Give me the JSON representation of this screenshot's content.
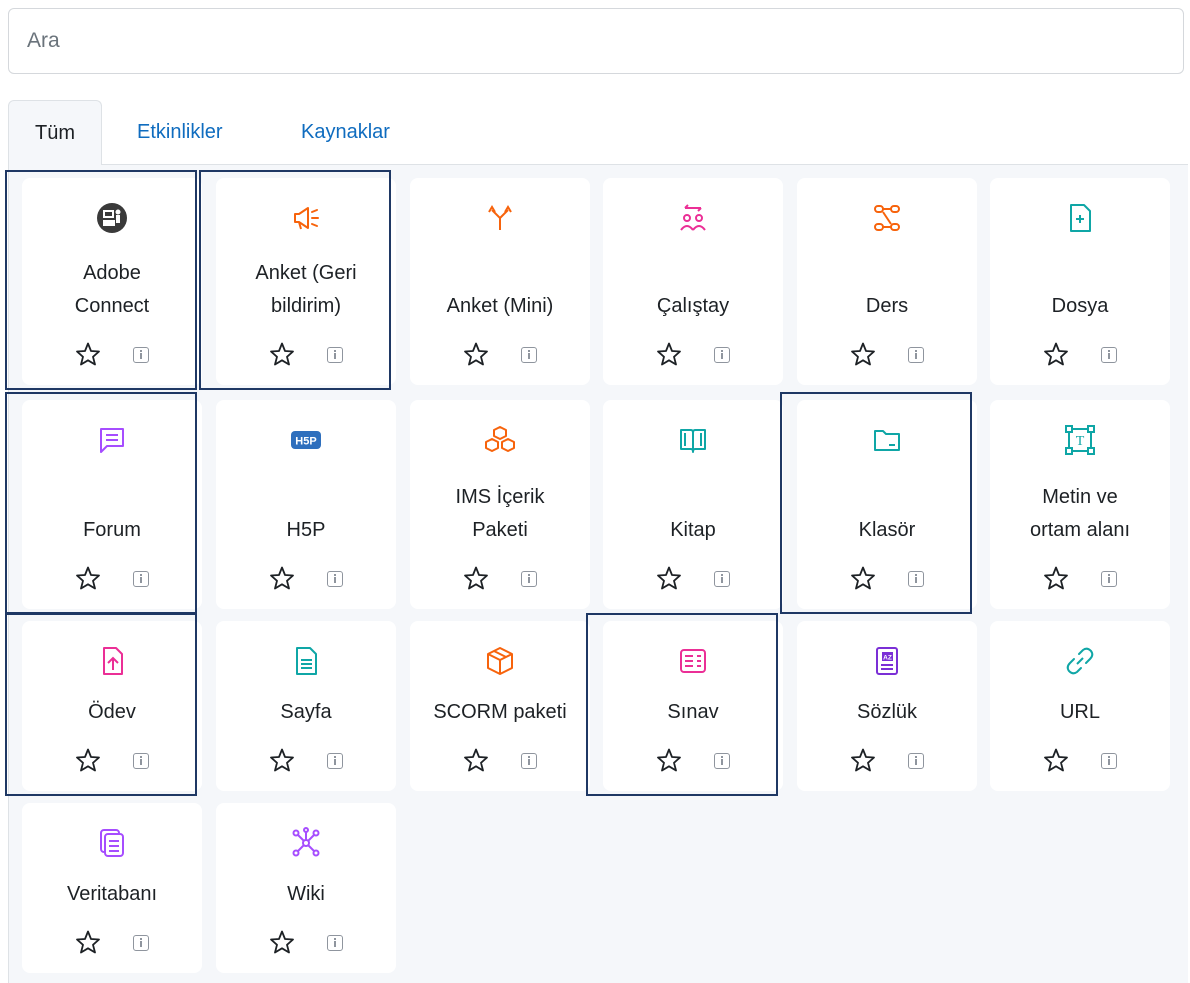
{
  "search": {
    "placeholder": "Ara",
    "value": ""
  },
  "tabs": [
    {
      "label": "Tüm",
      "active": true
    },
    {
      "label": "Etkinlikler",
      "active": false
    },
    {
      "label": "Kaynaklar",
      "active": false
    }
  ],
  "modules": [
    {
      "line1": "Adobe",
      "line2": "Connect",
      "icon": "adobe-connect-icon",
      "color": "#3a3a3a",
      "highlighted": true
    },
    {
      "line1": "Anket (Geri",
      "line2": "bildirim)",
      "icon": "megaphone-icon",
      "color": "#f7630c",
      "highlighted": true
    },
    {
      "line1": "",
      "line2": "Anket (Mini)",
      "icon": "split-arrow-icon",
      "color": "#f7630c",
      "highlighted": false
    },
    {
      "line1": "",
      "line2": "Çalıştay",
      "icon": "workshop-people-icon",
      "color": "#eb2f96",
      "highlighted": false
    },
    {
      "line1": "",
      "line2": "Ders",
      "icon": "lesson-path-icon",
      "color": "#f7630c",
      "highlighted": false
    },
    {
      "line1": "",
      "line2": "Dosya",
      "icon": "file-plus-icon",
      "color": "#0fa6a6",
      "highlighted": false
    },
    {
      "line1": "",
      "line2": "Forum",
      "icon": "forum-chat-icon",
      "color": "#a64dff",
      "highlighted": true
    },
    {
      "line1": "",
      "line2": "H5P",
      "icon": "h5p-icon",
      "color": "#2e6fbd",
      "highlighted": false
    },
    {
      "line1": "IMS İçerik",
      "line2": "Paketi",
      "icon": "ims-boxes-icon",
      "color": "#f7630c",
      "highlighted": false
    },
    {
      "line1": "",
      "line2": "Kitap",
      "icon": "book-icon",
      "color": "#0fa6a6",
      "highlighted": false
    },
    {
      "line1": "",
      "line2": "Klasör",
      "icon": "folder-icon",
      "color": "#0fa6a6",
      "highlighted": true
    },
    {
      "line1": "Metin ve",
      "line2": "ortam alanı",
      "icon": "text-media-icon",
      "color": "#0fa6a6",
      "highlighted": false
    },
    {
      "line1": "",
      "line2": "Ödev",
      "icon": "assignment-upload-icon",
      "color": "#eb2f96",
      "highlighted": true
    },
    {
      "line1": "",
      "line2": "Sayfa",
      "icon": "page-icon",
      "color": "#0fa6a6",
      "highlighted": false
    },
    {
      "line1": "",
      "line2": "SCORM paketi",
      "icon": "scorm-box-icon",
      "color": "#f7630c",
      "highlighted": false
    },
    {
      "line1": "",
      "line2": "Sınav",
      "icon": "quiz-icon",
      "color": "#eb2f96",
      "highlighted": true
    },
    {
      "line1": "",
      "line2": "Sözlük",
      "icon": "glossary-icon",
      "color": "#7b2fd6",
      "highlighted": false
    },
    {
      "line1": "",
      "line2": "URL",
      "icon": "link-icon",
      "color": "#0fa6a6",
      "highlighted": false
    },
    {
      "line1": "",
      "line2": "Veritabanı",
      "icon": "database-icon",
      "color": "#a64dff",
      "highlighted": false
    },
    {
      "line1": "",
      "line2": "Wiki",
      "icon": "wiki-network-icon",
      "color": "#a64dff",
      "highlighted": false
    }
  ]
}
